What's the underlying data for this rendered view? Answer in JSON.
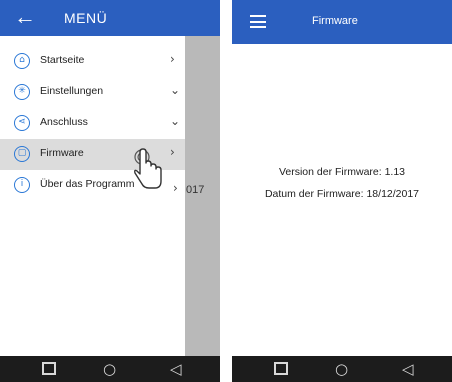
{
  "left_screen": {
    "drawer": {
      "title": "MENÜ",
      "back_icon": "arrow-left-icon",
      "items": [
        {
          "label": "Startseite",
          "icon": "home-icon",
          "chevron": "›"
        },
        {
          "label": "Einstellungen",
          "icon": "settings-icon",
          "chevron": "⌄"
        },
        {
          "label": "Anschluss",
          "icon": "share-icon",
          "chevron": "⌄"
        },
        {
          "label": "Firmware",
          "icon": "chip-icon",
          "chevron": "›",
          "active": true
        },
        {
          "label": "Über das Programm",
          "icon": "info-icon",
          "chevron": "›"
        }
      ]
    },
    "background_peek_text": "017",
    "pointer_icon": "hand-pointer-icon"
  },
  "right_screen": {
    "title": "Firmware",
    "menu_icon": "hamburger-icon",
    "version_text": "Version der Firmware: 1.13",
    "date_text": "Datum der Firmware: 18/12/2017"
  },
  "nav_bar": {
    "recent_icon": "square-icon",
    "home_icon": "circle-icon",
    "back_icon": "triangle-back-icon",
    "home_glyph": "○",
    "back_glyph": "◁"
  },
  "colors": {
    "primary": "#2b5fbf",
    "icon_blue": "#2b78d6",
    "active_item": "#dcdcdc",
    "nav_bar": "#1c1c1c"
  }
}
